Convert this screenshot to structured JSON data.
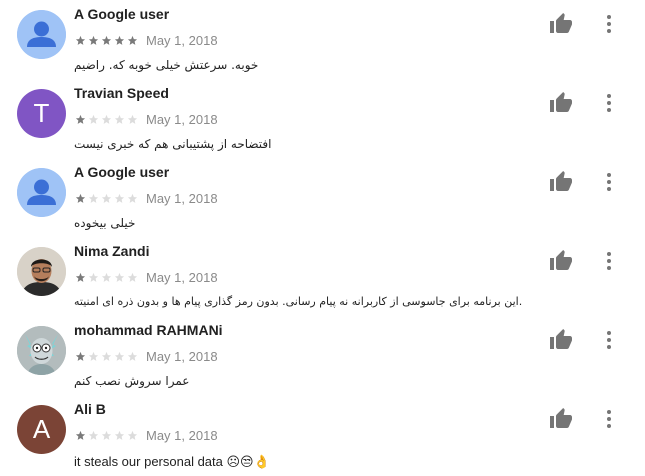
{
  "colors": {
    "star_filled": "#7a7a7a",
    "star_empty": "#dcdcdc",
    "date": "#8a8a8a",
    "icon": "#757575"
  },
  "reviews": [
    {
      "author": "A Google user",
      "rating": 5,
      "date": "May 1, 2018",
      "text": "خوبه. سرعتش خیلی خوبه که. راضیم",
      "avatar": "default-person-icon",
      "avatar_color": "#9fc3f6"
    },
    {
      "author": "Travian Speed",
      "rating": 1,
      "date": "May 1, 2018",
      "text": "افتضاحه از پشتیبانی هم که خبری نیست",
      "avatar": "letter",
      "avatar_letter": "T",
      "avatar_color": "#8055c4"
    },
    {
      "author": "A Google user",
      "rating": 1,
      "date": "May 1, 2018",
      "text": "خیلی بیخوده",
      "avatar": "default-person-icon",
      "avatar_color": "#9fc3f6"
    },
    {
      "author": "Nima Zandi",
      "rating": 1,
      "date": "May 1, 2018",
      "text": "این برنامه برای جاسوسی از کاربرانه نه پیام رسانی. بدون رمز گذاری پیام ها و بدون ذره ای امنیته.",
      "avatar": "photo-portrait"
    },
    {
      "author": "mohammad RAHMANi",
      "rating": 1,
      "date": "May 1, 2018",
      "text": "عمرا سروش نصب کنم",
      "avatar": "photo-cartoon"
    },
    {
      "author": "Ali B",
      "rating": 1,
      "date": "May 1, 2018",
      "text": "it steals our personal data ☹😒👌",
      "avatar": "letter",
      "avatar_letter": "A",
      "avatar_color": "#7b4436"
    }
  ]
}
